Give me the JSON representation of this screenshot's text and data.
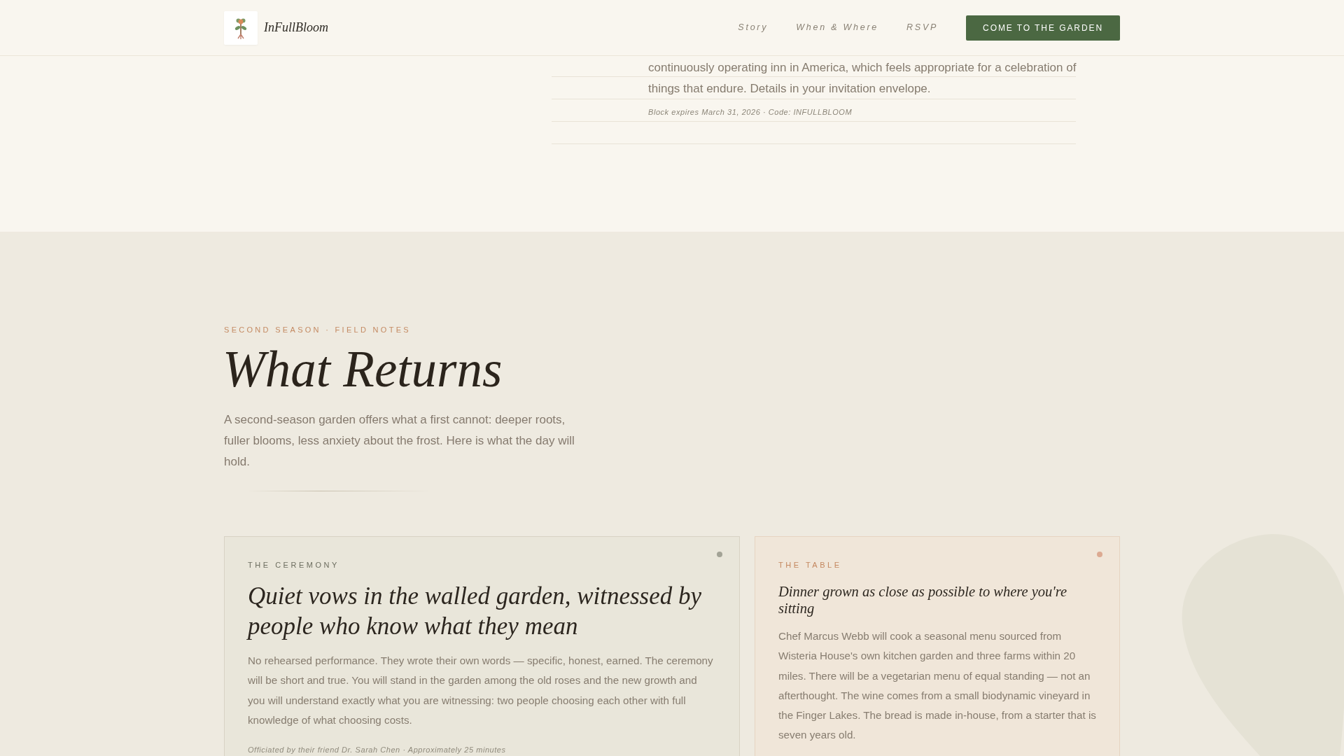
{
  "header": {
    "brand": "InFullBloom",
    "nav": [
      {
        "label": "Story"
      },
      {
        "label": "When & Where"
      },
      {
        "label": "RSVP"
      }
    ],
    "cta": "COME TO THE GARDEN"
  },
  "stay_note": {
    "text": "continuously operating inn in America, which feels appropriate for a celebration of things that endure. Details in your invitation envelope.",
    "meta": "Block expires March 31, 2026 · Code: INFULLBLOOM"
  },
  "day_section": {
    "eyebrow": "SECOND SEASON · FIELD NOTES",
    "title": "What Returns",
    "intro": "A second-season garden offers what a first cannot: deeper roots, fuller blooms, less anxiety about the frost. Here is what the day will hold."
  },
  "cards": [
    {
      "kind": "feature",
      "color": "#a3a396",
      "eyebrow": "THE CEREMONY",
      "title": "Quiet vows in the walled garden, witnessed by people who know what they mean",
      "body": "No rehearsed performance. They wrote their own words — specific, honest, earned. The ceremony will be short and true. You will stand in the garden among the old roses and the new growth and you will understand exactly what you are witnessing: two people choosing each other with full knowledge of what choosing costs.",
      "note": "Officiated by their friend Dr. Sarah Chen · Approximately 25 minutes"
    },
    {
      "kind": "side",
      "color": "#dcaa92",
      "eyebrow": "THE TABLE",
      "title": "Dinner grown as close as possible to where you're sitting",
      "body": "Chef Marcus Webb will cook a seasonal menu sourced from Wisteria House's own kitchen garden and three farms within 20 miles. There will be a vegetarian menu of equal standing — not an afterthought. The wine comes from a small biodynamic vineyard in the Finger Lakes. The bread is made in-house, from a starter that is seven years old."
    }
  ]
}
